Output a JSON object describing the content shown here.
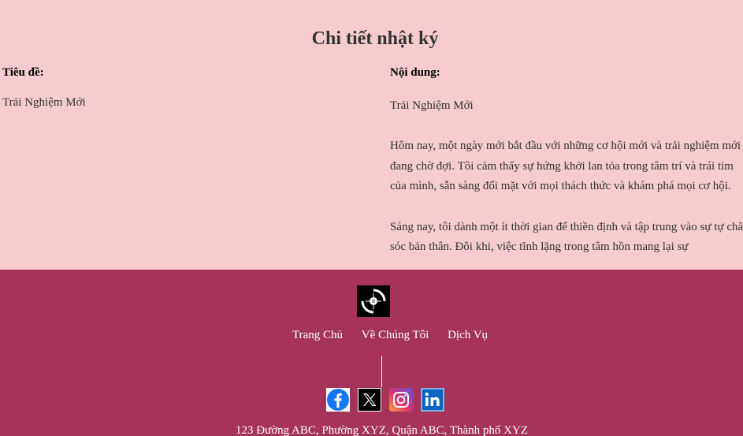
{
  "page": {
    "title": "Chi tiết nhật ký"
  },
  "entry": {
    "title_label": "Tiêu đề:",
    "title_value": "Trải Nghiệm Mới",
    "content_label": "Nội dung:",
    "content_heading": "Trải Nghiệm Mới",
    "paragraphs": [
      "Hôm nay, một ngày mới bắt đầu với những cơ hội mới và trải nghiệm mới đang chờ đợi. Tôi cảm thấy sự hứng khởi lan tỏa trong tâm trí và trái tim của mình, sẵn sàng đối mặt với mọi thách thức và khám phá mọi cơ hội.",
      "Sáng nay, tôi dành một ít thời gian để thiền định và tập trung vào sự tự chăm sóc bản thân. Đôi khi, việc tĩnh lặng trong tâm hồn mang lại sự"
    ]
  },
  "footer": {
    "nav": {
      "home": "Trang Chủ",
      "about": "Về Chúng Tôi",
      "services": "Dịch Vụ"
    },
    "social": [
      "facebook-icon",
      "x-twitter-icon",
      "instagram-icon",
      "linkedin-icon"
    ],
    "address": "123 Đường ABC, Phường XYZ, Quận ABC, Thành phố XYZ"
  },
  "colors": {
    "background": "#f6cccf",
    "footer": "#a5335a",
    "text": "#333333"
  }
}
